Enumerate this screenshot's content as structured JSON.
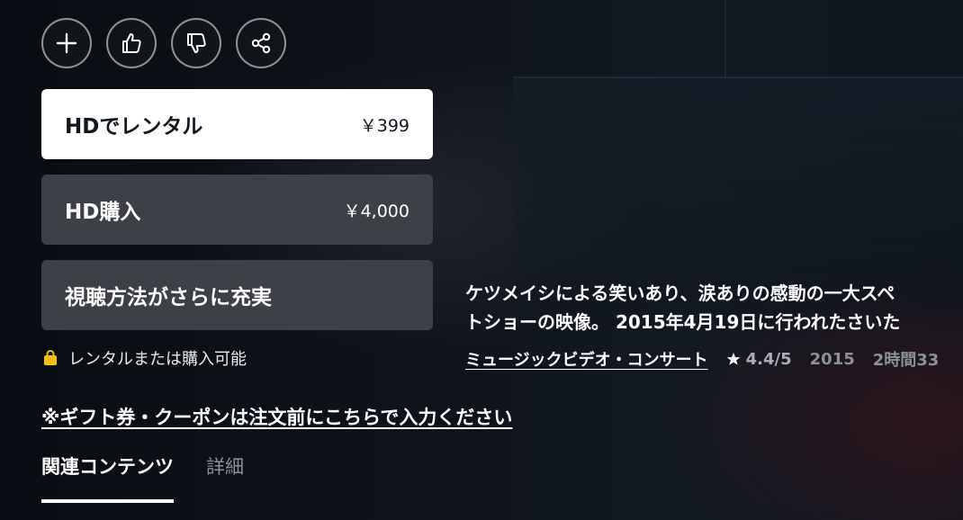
{
  "actions": {
    "add_icon": "plus-icon",
    "like_icon": "thumbs-up-icon",
    "dislike_icon": "thumbs-down-icon",
    "share_icon": "share-icon"
  },
  "purchase": {
    "rent": {
      "label": "HDでレンタル",
      "price": "￥399"
    },
    "buy": {
      "label": "HD購入",
      "price": "￥4,000"
    },
    "more": {
      "label": "視聴方法がさらに充実"
    }
  },
  "availability": {
    "icon": "shopping-bag-icon",
    "text": "レンタルまたは購入可能"
  },
  "gift_link": "※ギフト券・クーポンは注文前にこちらで入力ください",
  "tabs": [
    {
      "label": "関連コンテンツ",
      "active": true
    },
    {
      "label": "詳細",
      "active": false
    }
  ],
  "synopsis": {
    "line1": "ケツメイシによる笑いあり、涙ありの感動の一大スペ",
    "line2": "トショーの映像。 2015年4月19日に行われたさいた"
  },
  "meta": {
    "genre": "ミュージックビデオ・コンサート",
    "rating": "4.4/5",
    "year": "2015",
    "duration": "2時間33"
  },
  "colors": {
    "primary_button_bg": "#ffffff",
    "secondary_button_bg": "#3d4147",
    "availability_icon": "#f2c200"
  }
}
